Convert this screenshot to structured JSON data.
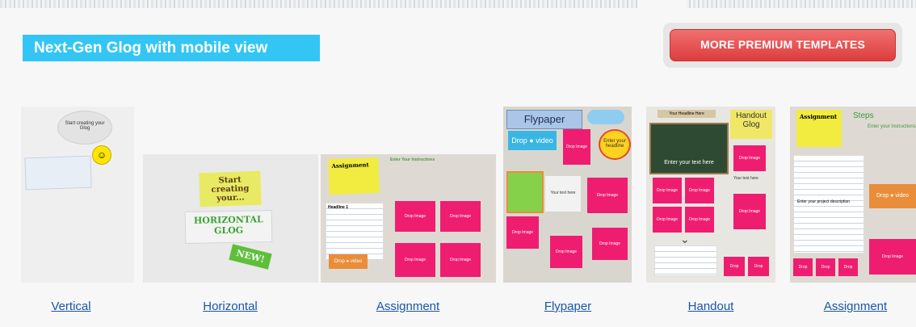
{
  "header": {
    "title": "Next-Gen Glog with mobile view",
    "premium_button": "MORE PREMIUM TEMPLATES"
  },
  "templates": [
    {
      "caption": "Vertical",
      "bubble_text": "Start creating your Glog"
    },
    {
      "caption": "Horizontal",
      "note_text": "Start creating your...",
      "banner_text": "HORIZONTAL GLOG",
      "badge_text": "NEW!"
    },
    {
      "caption": "Assignment",
      "note_title": "Assignment",
      "instructions": "Enter Your Instructions",
      "headline": "Headline 1",
      "drop_label": "Drop",
      "video_label": "video",
      "drop_image": "Drop Image",
      "your_text": "Your text here"
    },
    {
      "caption": "Flypaper",
      "title": "Flypaper",
      "drop_label": "Drop",
      "video_label": "video",
      "bubble_text": "Enter your headline",
      "drop_image": "Drop Image",
      "your_text": "Your text here"
    },
    {
      "caption": "Handout",
      "headline": "Your Headline Here",
      "title": "Handout Glog",
      "board_text": "Enter your text here",
      "drop_image": "Drop Image",
      "your_text": "Your text here"
    },
    {
      "caption": "Assignment",
      "note_title": "Assignment",
      "steps": "Steps",
      "instructions": "Enter your instructions",
      "project_text": "Enter your project description",
      "drop_label": "Drop",
      "video_label": "video",
      "drop_image": "Drop Image"
    }
  ]
}
